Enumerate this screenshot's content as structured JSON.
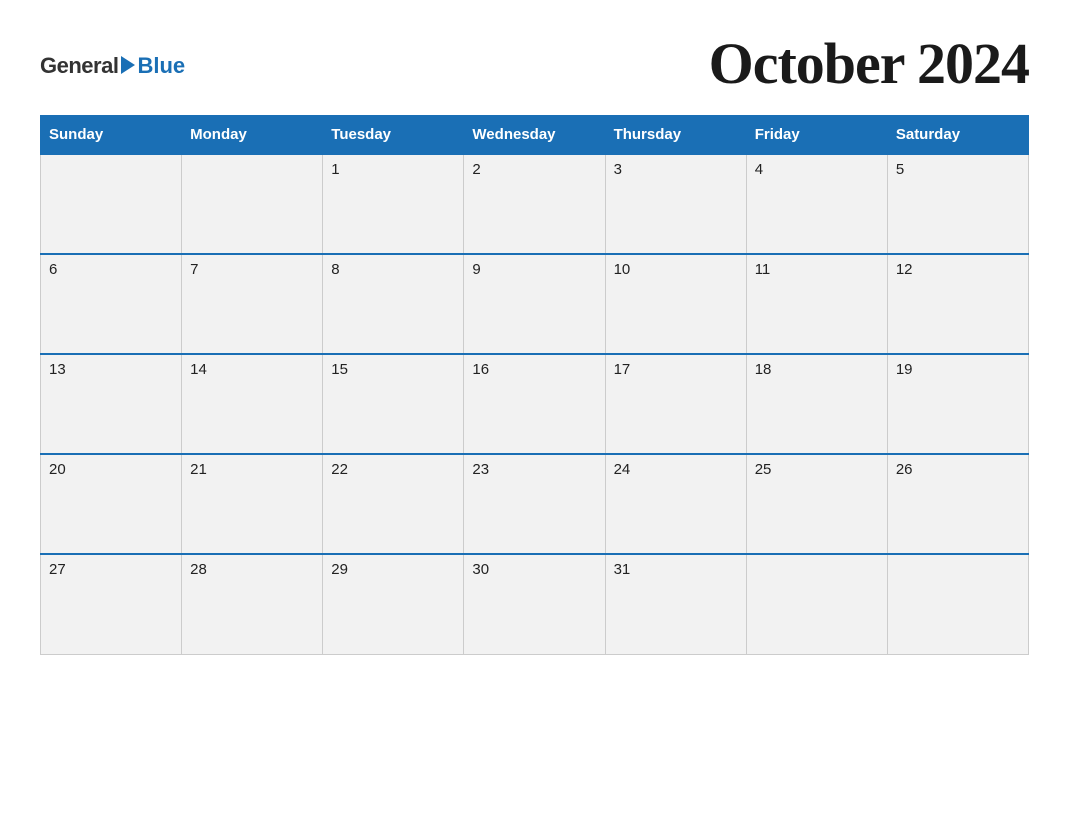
{
  "logo": {
    "general": "General",
    "blue": "Blue"
  },
  "title": "October 2024",
  "days": [
    "Sunday",
    "Monday",
    "Tuesday",
    "Wednesday",
    "Thursday",
    "Friday",
    "Saturday"
  ],
  "weeks": [
    [
      "",
      "",
      "1",
      "2",
      "3",
      "4",
      "5"
    ],
    [
      "6",
      "7",
      "8",
      "9",
      "10",
      "11",
      "12"
    ],
    [
      "13",
      "14",
      "15",
      "16",
      "17",
      "18",
      "19"
    ],
    [
      "20",
      "21",
      "22",
      "23",
      "24",
      "25",
      "26"
    ],
    [
      "27",
      "28",
      "29",
      "30",
      "31",
      "",
      ""
    ]
  ]
}
